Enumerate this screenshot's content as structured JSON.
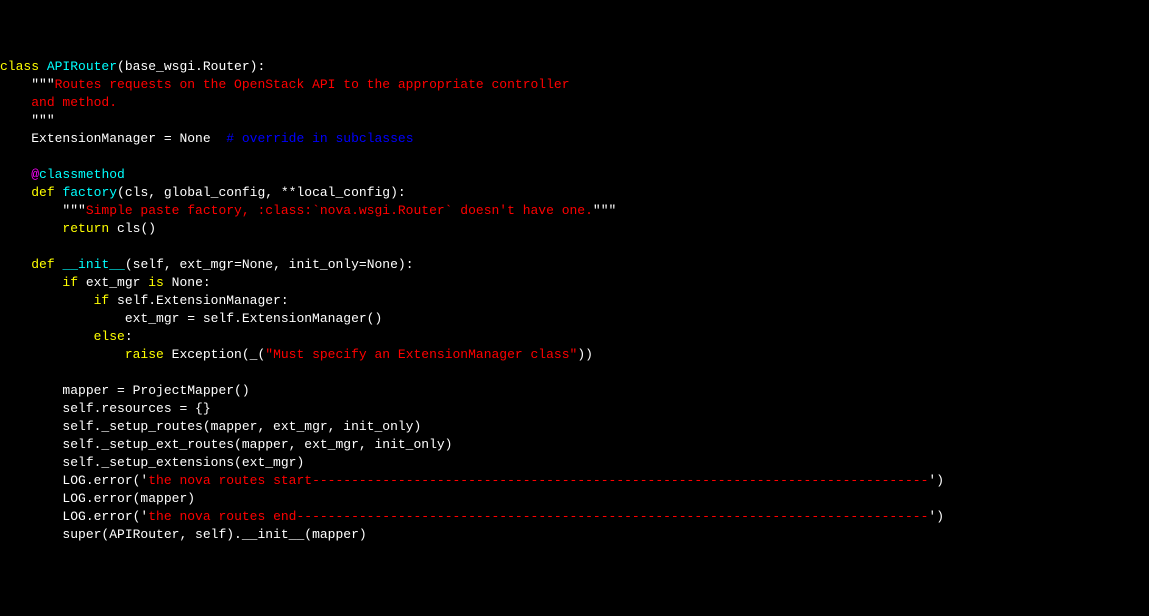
{
  "code": {
    "lines": [
      {
        "indent": 0,
        "segs": [
          [
            "kw",
            "class "
          ],
          [
            "name",
            "APIRouter"
          ],
          [
            "plain",
            "(base_wsgi.Router):"
          ]
        ]
      },
      {
        "indent": 1,
        "segs": [
          [
            "plain",
            "\"\"\""
          ],
          [
            "str",
            "Routes requests on the OpenStack API to the appropriate controller"
          ]
        ]
      },
      {
        "indent": 1,
        "segs": [
          [
            "str",
            "and method."
          ]
        ]
      },
      {
        "indent": 1,
        "segs": [
          [
            "plain",
            "\"\"\""
          ]
        ]
      },
      {
        "indent": 1,
        "segs": [
          [
            "plain",
            "ExtensionManager = None  "
          ],
          [
            "cmt",
            "# override in subclasses"
          ]
        ]
      },
      {
        "indent": 0,
        "segs": [
          [
            "plain",
            ""
          ]
        ]
      },
      {
        "indent": 1,
        "segs": [
          [
            "at",
            "@"
          ],
          [
            "dec",
            "classmethod"
          ]
        ]
      },
      {
        "indent": 1,
        "segs": [
          [
            "kw",
            "def "
          ],
          [
            "name",
            "factory"
          ],
          [
            "plain",
            "(cls, global_config, **local_config):"
          ]
        ]
      },
      {
        "indent": 2,
        "segs": [
          [
            "plain",
            "\"\"\""
          ],
          [
            "str",
            "Simple paste factory, :class:`nova.wsgi.Router` doesn't have one."
          ],
          [
            "plain",
            "\"\"\""
          ]
        ]
      },
      {
        "indent": 2,
        "segs": [
          [
            "kw",
            "return"
          ],
          [
            "plain",
            " cls()"
          ]
        ]
      },
      {
        "indent": 0,
        "segs": [
          [
            "plain",
            ""
          ]
        ]
      },
      {
        "indent": 1,
        "segs": [
          [
            "kw",
            "def "
          ],
          [
            "name",
            "__init__"
          ],
          [
            "plain",
            "(self, ext_mgr=None, init_only=None):"
          ]
        ]
      },
      {
        "indent": 2,
        "segs": [
          [
            "kw",
            "if"
          ],
          [
            "plain",
            " ext_mgr "
          ],
          [
            "kw",
            "is"
          ],
          [
            "plain",
            " None:"
          ]
        ]
      },
      {
        "indent": 3,
        "segs": [
          [
            "kw",
            "if"
          ],
          [
            "plain",
            " self.ExtensionManager:"
          ]
        ]
      },
      {
        "indent": 4,
        "segs": [
          [
            "plain",
            "ext_mgr = self.ExtensionManager()"
          ]
        ]
      },
      {
        "indent": 3,
        "segs": [
          [
            "kw",
            "else"
          ],
          [
            "plain",
            ":"
          ]
        ]
      },
      {
        "indent": 4,
        "segs": [
          [
            "kw",
            "raise"
          ],
          [
            "plain",
            " Exception(_("
          ],
          [
            "str",
            "\"Must specify an ExtensionManager class\""
          ],
          [
            "plain",
            "))"
          ]
        ]
      },
      {
        "indent": 0,
        "segs": [
          [
            "plain",
            ""
          ]
        ]
      },
      {
        "indent": 2,
        "segs": [
          [
            "plain",
            "mapper = ProjectMapper()"
          ]
        ]
      },
      {
        "indent": 2,
        "segs": [
          [
            "plain",
            "self.resources = {}"
          ]
        ]
      },
      {
        "indent": 2,
        "segs": [
          [
            "plain",
            "self._setup_routes(mapper, ext_mgr, init_only)"
          ]
        ]
      },
      {
        "indent": 2,
        "segs": [
          [
            "plain",
            "self._setup_ext_routes(mapper, ext_mgr, init_only)"
          ]
        ]
      },
      {
        "indent": 2,
        "segs": [
          [
            "plain",
            "self._setup_extensions(ext_mgr)"
          ]
        ]
      },
      {
        "indent": 2,
        "segs": [
          [
            "plain",
            "LOG.error('"
          ],
          [
            "str",
            "the nova routes start-------------------------------------------------------------------------------"
          ],
          [
            "plain",
            "')"
          ]
        ]
      },
      {
        "indent": 2,
        "segs": [
          [
            "plain",
            "LOG.error(mapper)"
          ]
        ]
      },
      {
        "indent": 2,
        "segs": [
          [
            "plain",
            "LOG.error('"
          ],
          [
            "str",
            "the nova routes end---------------------------------------------------------------------------------"
          ],
          [
            "plain",
            "')"
          ]
        ]
      },
      {
        "indent": 2,
        "segs": [
          [
            "plain",
            "super(APIRouter, self).__init__(mapper)"
          ]
        ]
      }
    ]
  }
}
